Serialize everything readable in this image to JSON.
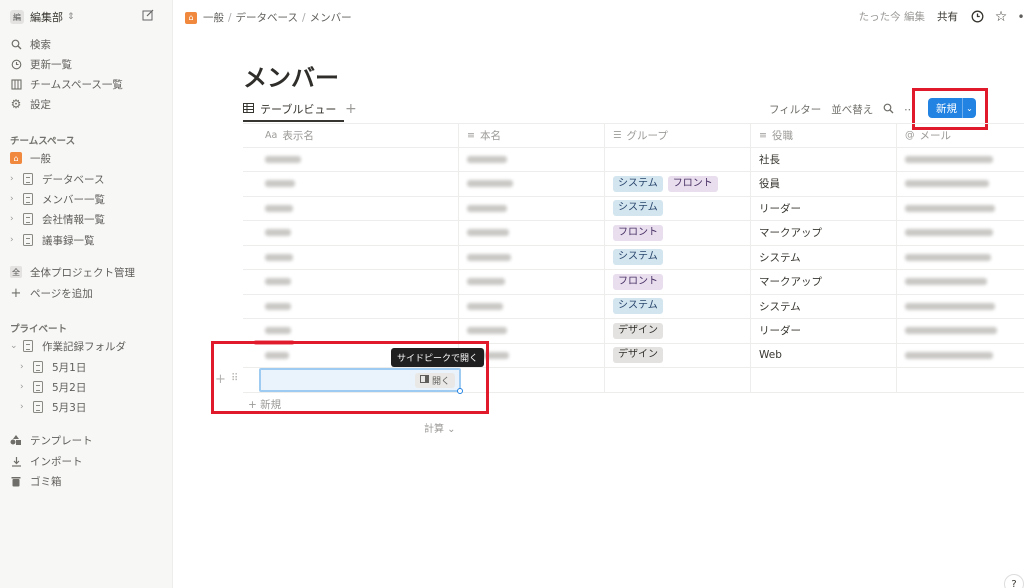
{
  "sidebar": {
    "workspace_badge": "編",
    "workspace_name": "編集部",
    "nav": [
      {
        "label": "検索",
        "icon": "search-icon"
      },
      {
        "label": "更新一覧",
        "icon": "clock-icon"
      },
      {
        "label": "チームスペース一覧",
        "icon": "building-icon"
      },
      {
        "label": "設定",
        "icon": "gear-icon"
      }
    ],
    "teamspace_header": "チームスペース",
    "teamspace_items": [
      "一般",
      "データベース",
      "メンバー一覧",
      "会社情報一覧",
      "議事録一覧"
    ],
    "all_projects": "全体プロジェクト管理",
    "all_badge": "全",
    "add_page": "ページを追加",
    "private_header": "プライベート",
    "private_folder": "作業記録フォルダ",
    "private_pages": [
      "5月1日",
      "5月2日",
      "5月3日"
    ],
    "bottom": [
      {
        "label": "テンプレート",
        "icon": "template-icon"
      },
      {
        "label": "インポート",
        "icon": "download-icon"
      },
      {
        "label": "ゴミ箱",
        "icon": "trash-icon"
      }
    ]
  },
  "topbar": {
    "breadcrumb": [
      "一般",
      "データベース",
      "メンバー"
    ],
    "edited": "たった今 編集",
    "share": "共有"
  },
  "page": {
    "title": "メンバー",
    "view_tab": "テーブルビュー",
    "filter": "フィルター",
    "sort": "並べ替え",
    "new_button": "新規"
  },
  "table": {
    "columns": [
      {
        "prefix": "Aa",
        "label": "表示名"
      },
      {
        "prefix": "≡",
        "label": "本名"
      },
      {
        "prefix": "☰",
        "label": "グループ"
      },
      {
        "prefix": "≡",
        "label": "役職"
      },
      {
        "prefix": "@",
        "label": "メール"
      }
    ],
    "rows": [
      {
        "groups": [],
        "role": "社長"
      },
      {
        "groups": [
          {
            "name": "システム",
            "color": "blue"
          },
          {
            "name": "フロント",
            "color": "purple"
          }
        ],
        "role": "役員"
      },
      {
        "groups": [
          {
            "name": "システム",
            "color": "blue"
          }
        ],
        "role": "リーダー"
      },
      {
        "groups": [
          {
            "name": "フロント",
            "color": "purple"
          }
        ],
        "role": "マークアップ"
      },
      {
        "groups": [
          {
            "name": "システム",
            "color": "blue"
          }
        ],
        "role": "システム"
      },
      {
        "groups": [
          {
            "name": "フロント",
            "color": "purple"
          }
        ],
        "role": "マークアップ"
      },
      {
        "groups": [
          {
            "name": "システム",
            "color": "blue"
          }
        ],
        "role": "システム"
      },
      {
        "groups": [
          {
            "name": "デザイン",
            "color": "gray"
          }
        ],
        "role": "リーダー"
      },
      {
        "groups": [
          {
            "name": "デザイン",
            "color": "gray"
          }
        ],
        "role": "Web"
      }
    ],
    "open_chip": "開く",
    "tooltip": "サイドピークで開く",
    "new_row": "新規",
    "calc": "計算"
  },
  "help": "?"
}
